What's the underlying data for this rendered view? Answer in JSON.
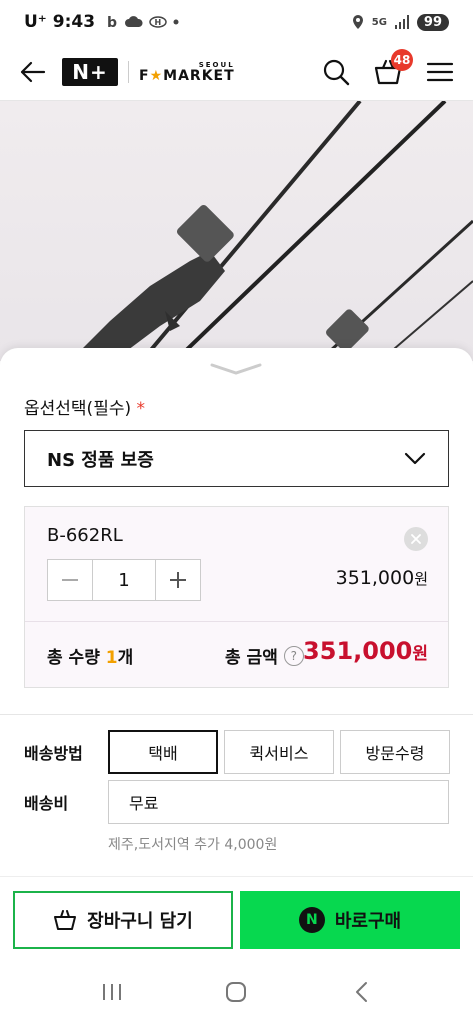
{
  "status_bar": {
    "carrier": "U⁺",
    "time": "9:43",
    "network": "5G",
    "battery": "99"
  },
  "header": {
    "logo_nplus": "N+",
    "logo_seoul": "SEOUL",
    "logo_fmarket_prefix": "F",
    "logo_star": "★",
    "logo_fmarket_suffix": "MARKET",
    "cart_count": "48"
  },
  "options": {
    "label": "옵션선택(필수)",
    "required_mark": "*",
    "selected": "NS 정품 보증"
  },
  "item": {
    "name": "B-662RL",
    "quantity": "1",
    "price": "351,000",
    "price_unit": "원"
  },
  "totals": {
    "qty_label": "총 수량 ",
    "qty_value": "1",
    "qty_unit": "개",
    "amount_label": "총 금액",
    "help": "?",
    "amount": "351,000",
    "amount_unit": "원"
  },
  "shipping": {
    "method_label": "배송방법",
    "methods": [
      "택배",
      "퀵서비스",
      "방문수령"
    ],
    "selected_index": 0,
    "fee_label": "배송비",
    "fee_value": "무료",
    "note": "제주,도서지역 추가 4,000원"
  },
  "actions": {
    "cart_label": "장바구니 담기",
    "buy_label": "바로구매",
    "buy_badge": "N"
  },
  "colors": {
    "accent_green": "#07d84f",
    "price_red": "#c8102e",
    "badge_red": "#e8392b",
    "qty_orange": "#f2a000"
  }
}
